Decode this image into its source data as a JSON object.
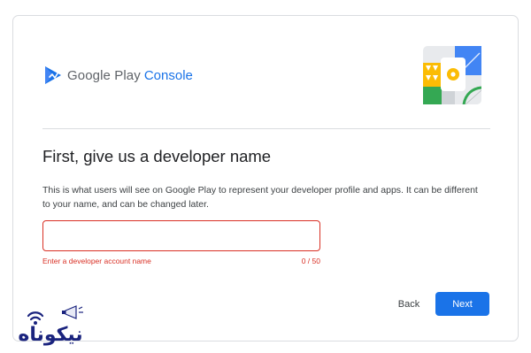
{
  "header": {
    "logo_text_google": "Google Play",
    "logo_text_console": "Console"
  },
  "main": {
    "heading": "First, give us a developer name",
    "description": "This is what users will see on Google Play to represent your developer profile and apps. It can be different to your name, and can be changed later.",
    "name_field": {
      "value": "",
      "placeholder": "",
      "error_message": "Enter a developer account name",
      "char_counter": "0 / 50"
    }
  },
  "footer": {
    "back_label": "Back",
    "next_label": "Next"
  },
  "watermark": {
    "text": "نیکوناه"
  },
  "colors": {
    "accent": "#1a73e8",
    "error": "#d93025",
    "border": "#dadce0",
    "text_primary": "#202124",
    "text_secondary": "#3c4043"
  },
  "icons": {
    "logo": "google-play-console-logo",
    "illustration": "developer-illustration",
    "watermark": "wifi-megaphone-icon"
  }
}
